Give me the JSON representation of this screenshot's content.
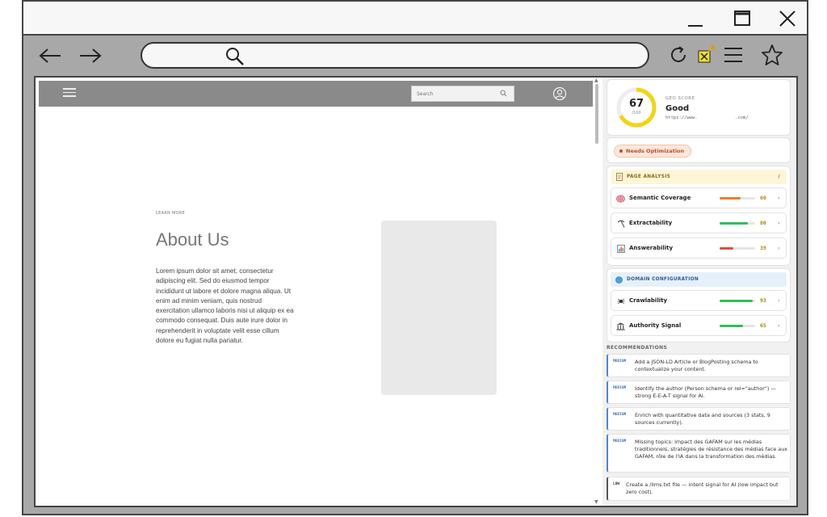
{
  "browser": {
    "url": ""
  },
  "site": {
    "search_placeholder": "Search",
    "learn_more": "LEARN MORE",
    "about_title": "About Us",
    "about_body": "Lorem ipsum dolor sit amet, consectetur adipiscing elit. Sed do eiusmod tempor incididunt ut labore et dolore magna aliqua. Ut enim ad minim veniam, quis nostrud exercitation ullamco laboris nisi ut aliquip ex ea commodo consequat. Duis aute irure dolor in reprehenderit in voluptate velit esse cillum dolore eu fugiat nulla pariatur."
  },
  "panel": {
    "score": {
      "value": "67",
      "denominator": "/100",
      "fraction": 0.67,
      "label": "GEO SCORE",
      "status": "Good",
      "url": "https://www.              .com/",
      "ring_color": "#f2d417"
    },
    "badge": "Needs Optimization",
    "page_analysis": {
      "title": "PAGE ANALYSIS",
      "slash": "/",
      "metrics": [
        {
          "label": "Semantic Coverage",
          "value": "60",
          "fraction": 0.6,
          "color": "#f07a2a",
          "icon": "brain-icon"
        },
        {
          "label": "Extractability",
          "value": "80",
          "fraction": 0.8,
          "color": "#2fbf5a",
          "icon": "pickaxe-icon"
        },
        {
          "label": "Answerability",
          "value": "39",
          "fraction": 0.39,
          "color": "#e84848",
          "icon": "chart-icon"
        }
      ]
    },
    "domain_config": {
      "title": "DOMAIN CONFIGURATION",
      "metrics": [
        {
          "label": "Crawlability",
          "value": "93",
          "fraction": 0.93,
          "color": "#2fbf5a",
          "icon": "spider-icon"
        },
        {
          "label": "Authority Signal",
          "value": "65",
          "fraction": 0.65,
          "color": "#2fbf5a",
          "icon": "building-icon"
        }
      ]
    },
    "recommendations_title": "RECOMMENDATIONS",
    "recommendations": [
      {
        "priority": "MEDIUM",
        "text": "Add a JSON-LD Article or BlogPosting schema to contextualize your content."
      },
      {
        "priority": "MEDIUM",
        "text": "Identify the author (Person schema or rel=\"author\") — strong E-E-A-T signal for AI."
      },
      {
        "priority": "MEDIUM",
        "text": "Enrich with quantitative data and sources (3 stats, 9 sources currently)."
      },
      {
        "priority": "MEDIUM",
        "text": "Missing topics: impact des GAFAM sur les médias traditionnels, stratégies de résistance des médias face aux GAFAM, rôle de l'IA dans la transformation des médias."
      },
      {
        "priority": "LOW",
        "text": "Create a /llms.txt file — intent signal for AI (low impact but zero cost)."
      }
    ]
  }
}
